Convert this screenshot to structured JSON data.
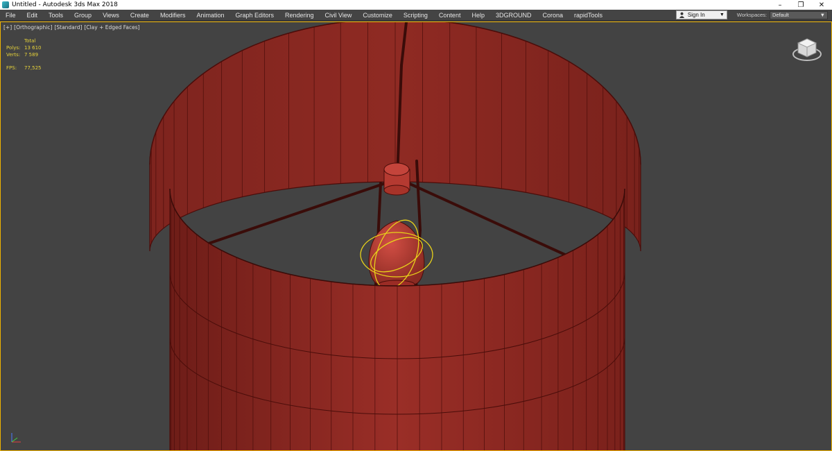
{
  "window": {
    "title": "Untitled - Autodesk 3ds Max 2018",
    "controls": {
      "minimize": "–",
      "restore": "❐",
      "close": "✕"
    }
  },
  "menubar": {
    "items": [
      "File",
      "Edit",
      "Tools",
      "Group",
      "Views",
      "Create",
      "Modifiers",
      "Animation",
      "Graph Editors",
      "Rendering",
      "Civil View",
      "Customize",
      "Scripting",
      "Content",
      "Help",
      "3DGROUND",
      "Corona",
      "rapidTools"
    ],
    "signin": {
      "label": "Sign In",
      "arrow": "▼"
    },
    "workspaces": {
      "label": "Workspaces:",
      "value": "Default",
      "arrow": "▼"
    }
  },
  "viewport": {
    "label": {
      "plus": "[+]",
      "view": "[Orthographic]",
      "shading": "[Standard]",
      "style": "[Clay + Edged Faces]"
    },
    "stats": {
      "header": "Total",
      "polys_label": "Polys:",
      "polys_value": "13 610",
      "verts_label": "Verts:",
      "verts_value": "7 589",
      "fps_label": "FPS:",
      "fps_value": "77,525"
    },
    "colors": {
      "background": "#434343",
      "shade": "#8f2a24",
      "shade_light": "#c9483f",
      "wire": "#4a0d0a",
      "selection": "#e8d21a",
      "active_border": "#f0b400"
    }
  }
}
